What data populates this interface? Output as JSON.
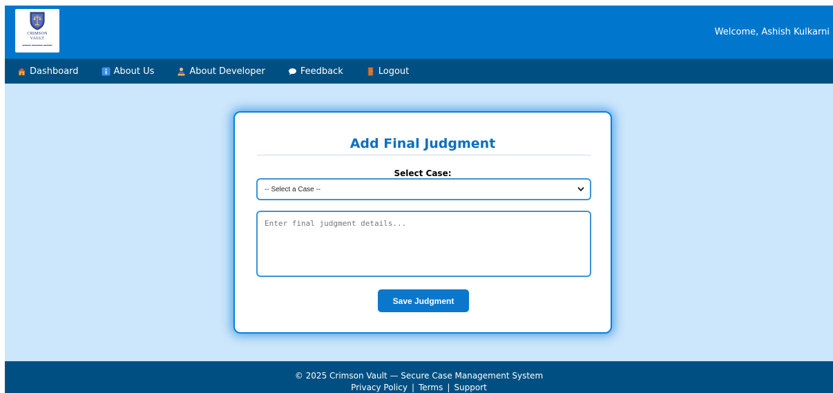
{
  "header": {
    "logo_name_line1": "CRIMSON",
    "logo_name_line2": "VAULT",
    "welcome_text": "Welcome, Ashish Kulkarni"
  },
  "nav": {
    "items": [
      {
        "label": "Dashboard",
        "icon": "house-icon"
      },
      {
        "label": "About Us",
        "icon": "info-icon"
      },
      {
        "label": "About Developer",
        "icon": "developer-icon"
      },
      {
        "label": "Feedback",
        "icon": "speech-bubble-icon"
      },
      {
        "label": "Logout",
        "icon": "door-icon"
      }
    ]
  },
  "form": {
    "title": "Add Final Judgment",
    "select_label": "Select Case:",
    "select_value": "-- Select a Case --",
    "textarea_placeholder": "Enter final judgment details...",
    "save_label": "Save Judgment"
  },
  "footer": {
    "copyright": "© 2025 Crimson Vault — Secure Case Management System",
    "links": [
      "Privacy Policy",
      "Terms",
      "Support"
    ],
    "separator": "|"
  },
  "colors": {
    "header_bg": "#0077cc",
    "nav_bg": "#004f82",
    "page_bg": "#cce6fb",
    "accent": "#0a77cc"
  }
}
